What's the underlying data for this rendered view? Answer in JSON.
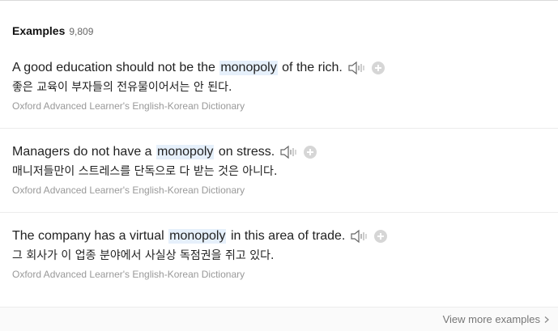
{
  "section": {
    "title": "Examples",
    "count": "9,809"
  },
  "examples": [
    {
      "pre": "A good education should not be the",
      "term": "monopoly",
      "post": "of the rich.",
      "translation": "좋은 교육이 부자들의 전유물이어서는 안 된다.",
      "source": "Oxford Advanced Learner's English-Korean Dictionary"
    },
    {
      "pre": "Managers do not have a",
      "term": "monopoly",
      "post": "on stress.",
      "translation": "매니저들만이 스트레스를 단독으로 다 받는 것은 아니다.",
      "source": "Oxford Advanced Learner's English-Korean Dictionary"
    },
    {
      "pre": "The company has a virtual",
      "term": "monopoly",
      "post": "in this area of trade.",
      "translation": "그 회사가 이 업종 분야에서 사실상 독점권을 쥐고 있다.",
      "source": "Oxford Advanced Learner's English-Korean Dictionary"
    }
  ],
  "footer": {
    "more_label": "View more examples"
  },
  "icons": {
    "speaker": "speaker-icon",
    "add": "plus-circle-icon",
    "chevron": "chevron-right-icon"
  },
  "colors": {
    "highlight": "#e6f0fb",
    "muted_text": "#999999",
    "add_button": "#d6d6d6"
  }
}
